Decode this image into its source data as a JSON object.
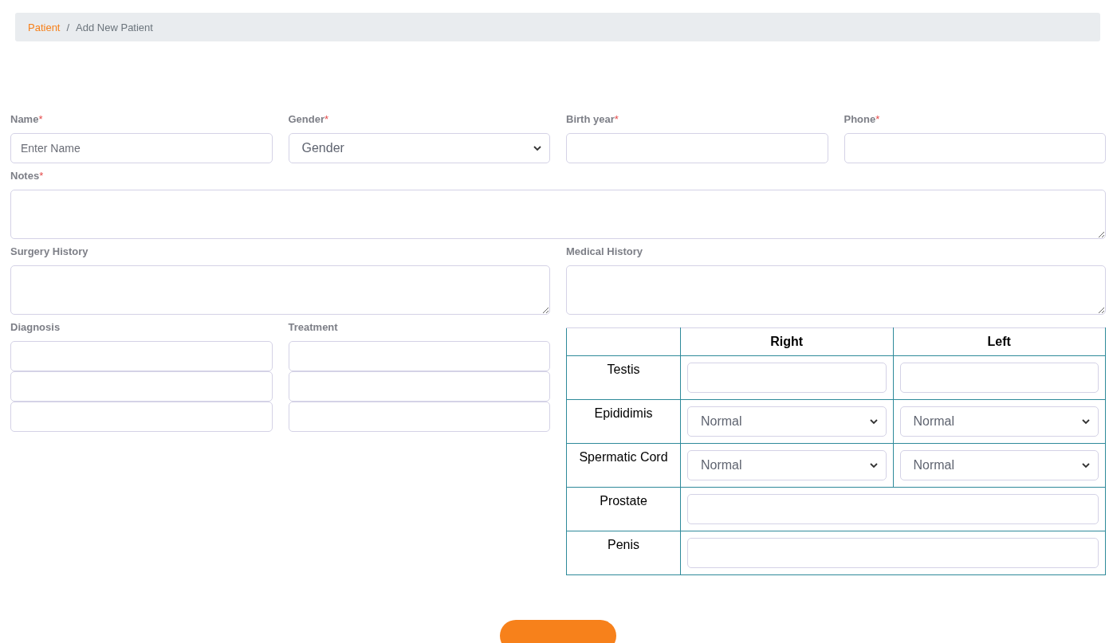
{
  "breadcrumb": [
    {
      "label": "Patient",
      "kind": "link"
    },
    {
      "label": "Add New Patient",
      "kind": "current"
    }
  ],
  "breadcrumb_separator": "/",
  "top_fields": [
    {
      "label": "Name",
      "required_mark": "*",
      "kind": "input",
      "placeholder": "Enter Name"
    },
    {
      "label": "Gender",
      "required_mark": "*",
      "kind": "select",
      "value": "Gender"
    },
    {
      "label": "Birth year",
      "required_mark": "*",
      "kind": "input"
    },
    {
      "label": "Phone",
      "required_mark": "*",
      "kind": "input"
    }
  ],
  "notes": {
    "label": "Notes",
    "required_mark": "*"
  },
  "history": [
    {
      "label": "Surgery History"
    },
    {
      "label": "Medical History"
    }
  ],
  "lists": [
    {
      "label": "Diagnosis"
    },
    {
      "label": "Treatment"
    }
  ],
  "exam_table": {
    "columns": [
      "Right",
      "Left"
    ],
    "rows": [
      {
        "label": "Testis",
        "kind": "inputs"
      },
      {
        "label": "Epididimis",
        "kind": "selects",
        "right": "Normal",
        "left": "Normal"
      },
      {
        "label": "Spermatic Cord",
        "kind": "selects",
        "right": "Normal",
        "left": "Normal"
      },
      {
        "label": "Prostate",
        "kind": "wide"
      },
      {
        "label": "Penis",
        "kind": "wide"
      }
    ]
  }
}
